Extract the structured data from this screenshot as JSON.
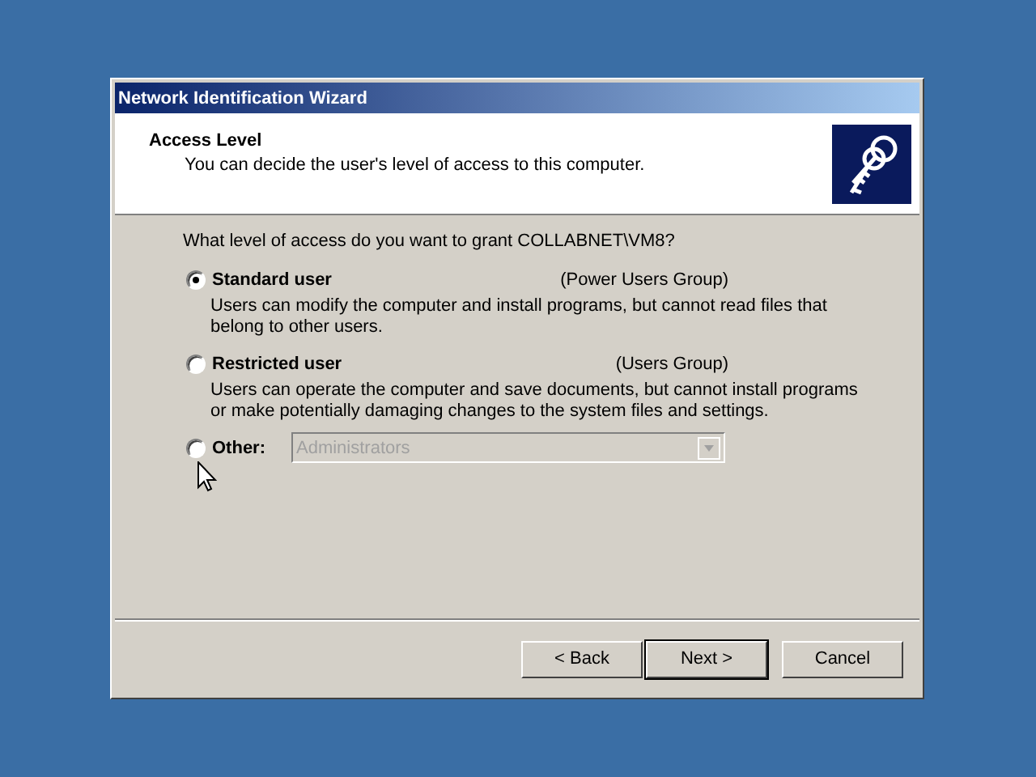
{
  "window": {
    "title": "Network Identification Wizard"
  },
  "header": {
    "title": "Access Level",
    "subtitle": "You can decide the user's level of access to this computer."
  },
  "question": "What level of access do you want to grant COLLABNET\\VM8?",
  "options": [
    {
      "kind": "description",
      "label": "Standard user",
      "group": "(Power Users Group)",
      "description": "Users can modify the computer and install programs, but cannot read files that belong to other users.",
      "selected": true
    },
    {
      "kind": "description",
      "label": "Restricted user",
      "group": "(Users Group)",
      "description": "Users can operate the computer and save documents, but cannot install programs or make potentially damaging changes to the system files and settings.",
      "selected": false
    },
    {
      "kind": "dropdown",
      "label": "Other:",
      "value": "Administrators",
      "disabled": true,
      "selected": false
    }
  ],
  "buttons": [
    {
      "label": "< Back",
      "default": false
    },
    {
      "label": "Next >",
      "default": true
    },
    {
      "label": "Cancel",
      "default": false
    }
  ]
}
